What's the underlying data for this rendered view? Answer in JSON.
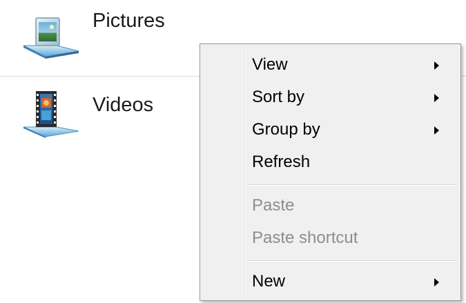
{
  "folders": [
    {
      "label": "Pictures",
      "icon": "pictures-library-icon"
    },
    {
      "label": "Videos",
      "icon": "videos-library-icon"
    }
  ],
  "context_menu": {
    "items": [
      {
        "label": "View",
        "submenu": true,
        "enabled": true
      },
      {
        "label": "Sort by",
        "submenu": true,
        "enabled": true
      },
      {
        "label": "Group by",
        "submenu": true,
        "enabled": true
      },
      {
        "label": "Refresh",
        "submenu": false,
        "enabled": true
      },
      {
        "label": "Paste",
        "submenu": false,
        "enabled": false
      },
      {
        "label": "Paste shortcut",
        "submenu": false,
        "enabled": false
      },
      {
        "label": "New",
        "submenu": true,
        "enabled": true
      }
    ]
  },
  "colors": {
    "menu_background": "#f0f0f0",
    "menu_border": "#979797",
    "disabled_text": "#8d8d8d"
  }
}
